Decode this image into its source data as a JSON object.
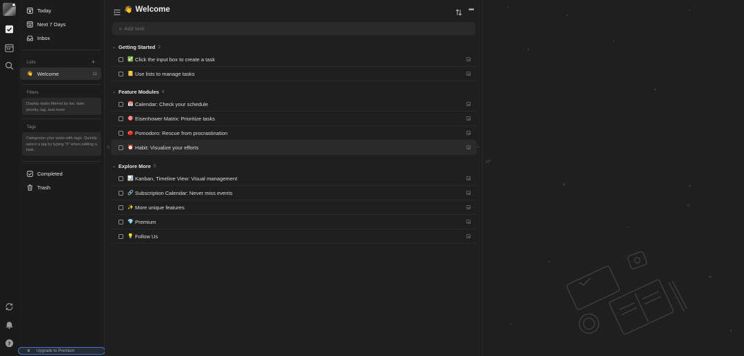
{
  "sidebar": {
    "nav": [
      {
        "label": "Today",
        "icon": "today-icon"
      },
      {
        "label": "Next 7 Days",
        "icon": "calendar-week-icon"
      },
      {
        "label": "Inbox",
        "icon": "inbox-icon"
      }
    ],
    "lists_label": "Lists",
    "lists": [
      {
        "emoji": "👋",
        "label": "Welcome",
        "count": "11"
      }
    ],
    "filters_label": "Filters",
    "filters_hint": "Display tasks filtered by list, date, priority, tag, and more",
    "tags_label": "Tags",
    "tags_hint": "Categorize your tasks with tags. Quickly select a tag by typing \"#\" when adding a task.",
    "completed_label": "Completed",
    "trash_label": "Trash",
    "upgrade_label": "Upgrade to Premium"
  },
  "main": {
    "title_emoji": "👋",
    "title": "Welcome",
    "add_task_placeholder": "Add task",
    "groups": [
      {
        "name": "Getting Started",
        "count": "2",
        "tasks": [
          {
            "emoji": "✅",
            "text": "Click the input box to create a task"
          },
          {
            "emoji": "📒",
            "text": "Use lists to manage tasks"
          }
        ]
      },
      {
        "name": "Feature Modules",
        "count": "4",
        "tasks": [
          {
            "emoji": "📅",
            "text": "Calendar: Check your schedule"
          },
          {
            "emoji": "🎯",
            "text": "Eisenhower Matrix: Prioritize tasks"
          },
          {
            "emoji": "🍅",
            "text": "Pomodoro: Rescue from procrastination"
          },
          {
            "emoji": "⏰",
            "text": "Habit: Visualize your efforts"
          }
        ]
      },
      {
        "name": "Explore More",
        "count": "5",
        "tasks": [
          {
            "emoji": "📊",
            "text": "Kanban, Timeline View: Visual management"
          },
          {
            "emoji": "🔗",
            "text": "Subscription Calendar: Never miss events"
          },
          {
            "emoji": "✨",
            "text": "More unique features"
          },
          {
            "emoji": "💎",
            "text": "Premium"
          },
          {
            "emoji": "💡",
            "text": "Follow Us"
          }
        ]
      }
    ]
  },
  "colors": {
    "background": "#1f1f1f",
    "sidebar": "#1c1c1c",
    "accent_upgrade": "#4a72d6"
  }
}
